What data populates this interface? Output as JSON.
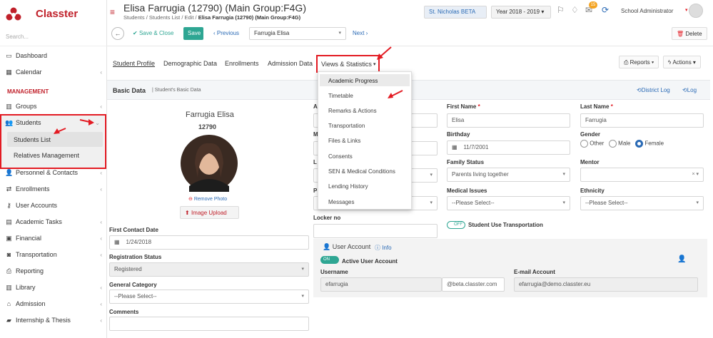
{
  "app": {
    "name": "Classter",
    "search_placeholder": "Search..."
  },
  "sidebar": {
    "items": [
      {
        "label": "Dashboard",
        "icon": "monitor-icon"
      },
      {
        "label": "Calendar",
        "icon": "calendar-icon"
      }
    ],
    "section_label": "MANAGEMENT",
    "mgmt_items": [
      {
        "label": "Groups"
      },
      {
        "label": "Students"
      },
      {
        "label": "Personnel & Contacts"
      },
      {
        "label": "Enrollments"
      },
      {
        "label": "User Accounts"
      },
      {
        "label": "Academic Tasks"
      },
      {
        "label": "Financial"
      },
      {
        "label": "Transportation"
      },
      {
        "label": "Reporting"
      },
      {
        "label": "Library"
      },
      {
        "label": "Admission"
      },
      {
        "label": "Internship & Thesis"
      }
    ],
    "students_sub": [
      "Students List",
      "Relatives Management"
    ]
  },
  "header": {
    "title": "Elisa Farrugia (12790) (Main Group:F4G)",
    "crumb_1": "Students",
    "crumb_2": "Students List",
    "crumb_3": "Edit",
    "crumb_4": "Elisa Farrugia (12790) (Main Group:F4G)",
    "school": "St. Nicholas BETA",
    "year": "Year 2018 - 2019",
    "notif_count": "15",
    "user": "School Administrator"
  },
  "toolbar": {
    "save_close": "Save & Close",
    "save": "Save",
    "previous": "Previous",
    "selected_student": "Farrugia Elisa",
    "next": "Next",
    "delete": "Delete"
  },
  "tabs": [
    "Student Profile",
    "Demographic Data",
    "Enrollments",
    "Admission Data",
    "Views & Statistics"
  ],
  "actions": {
    "reports": "Reports",
    "actions": "Actions"
  },
  "basic": {
    "title": "Basic Data",
    "subtitle": "Student's Basic Data",
    "district_log": "District Log",
    "log": "Log"
  },
  "profile": {
    "name": "Farrugia Elisa",
    "id": "12790",
    "remove_photo": "Remove Photo",
    "upload": "Image Upload"
  },
  "left_fields": {
    "first_contact_label": "First Contact Date",
    "first_contact_value": "1/24/2018",
    "reg_status_label": "Registration Status",
    "reg_status_value": "Registered",
    "gen_cat_label": "General Category",
    "gen_cat_value": "--Please Select--",
    "comments_label": "Comments"
  },
  "col_cut": {
    "a": "A",
    "m": "M",
    "l": "L",
    "p": "P",
    "locker": "Locker no"
  },
  "fields": {
    "first_name_label": "First Name",
    "first_name": "Elisa",
    "last_name_label": "Last Name",
    "last_name": "Farrugia",
    "birthday_label": "Birthday",
    "birthday": "11/7/2001",
    "gender_label": "Gender",
    "gender_options": [
      "Other",
      "Male",
      "Female"
    ],
    "family_label": "Family Status",
    "family_value": "Parents living together",
    "mentor_label": "Mentor",
    "medical_label": "Medical Issues",
    "medical_value": "--Please Select--",
    "ethnicity_label": "Ethnicity",
    "ethnicity_value": "--Please Select--",
    "transport_label": "Student Use Transportation",
    "toggle_off": "OFF",
    "toggle_on": "ON"
  },
  "account": {
    "title": "User Account",
    "info": "Info",
    "active": "Active User Account",
    "username_label": "Username",
    "username": "efarrugia",
    "domain": "@beta.classter.com",
    "email_label": "E-mail Account",
    "email": "efarrugia@demo.classter.eu"
  },
  "menu": {
    "items": [
      "Academic Progress",
      "Timetable",
      "Remarks & Actions",
      "Transportation",
      "Files & Links",
      "Consents",
      "SEN & Medical Conditions",
      "Lending History",
      "Messages"
    ]
  },
  "colors": {
    "brand": "#c0202a",
    "accent": "#2a6ab5",
    "save": "#2ea693",
    "highlight": "#e31b23"
  }
}
